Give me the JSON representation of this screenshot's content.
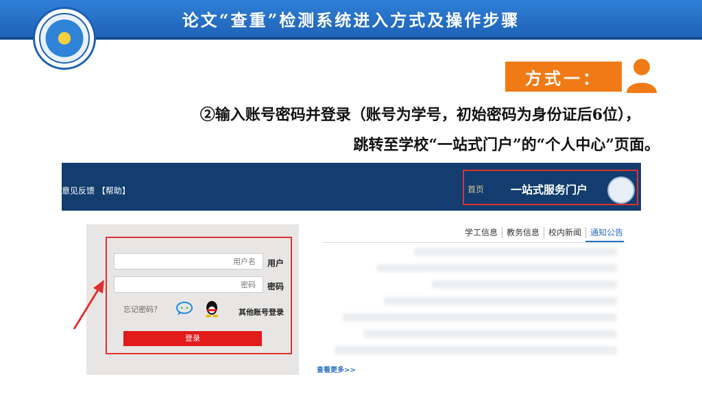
{
  "slide": {
    "title": "论文“查重”检测系统进入方式及操作步骤",
    "method_label": "方式一：",
    "step_line1": "②输入账号密码并登录（账号为学号，初始密码为身份证后6位），",
    "step_line2": "跳转至学校“一站式门户”的“个人中心”页面。"
  },
  "portal": {
    "nav": {
      "feedback": "意见反馈 【帮助】",
      "home": "首页",
      "title": "一站式服务门户"
    },
    "login": {
      "user_label": "用户",
      "user_placeholder": "用户名",
      "password_label": "密码",
      "password_placeholder": "密码",
      "other_login": "其他账号登录",
      "forgot": "忘记密码？",
      "login_button": "登录"
    },
    "tabs": [
      "通知公告",
      "校内新闻",
      "教务信息",
      "学工信息"
    ],
    "see_more": "查看更多>>"
  },
  "colors": {
    "header_blue": "#1f63b8",
    "orange": "#f07b16",
    "portal_nav": "#123d6e",
    "highlight_red": "#e03030",
    "login_red": "#e21b1b",
    "link_blue": "#2a6fc2"
  }
}
